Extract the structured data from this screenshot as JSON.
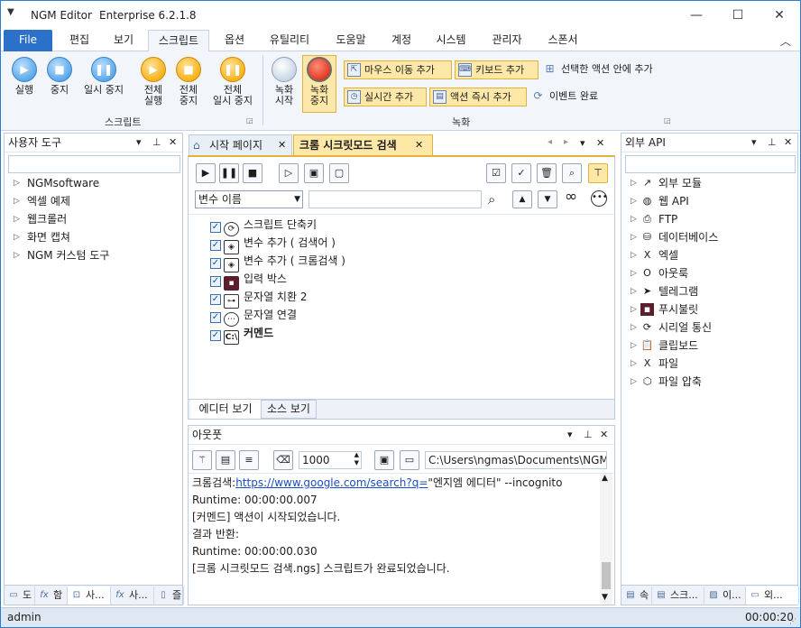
{
  "window": {
    "app_name": "NGM Editor",
    "edition": "Enterprise 6.2.1.8"
  },
  "menu": {
    "tabs": [
      "File",
      "편집",
      "보기",
      "스크립트",
      "옵션",
      "유틸리티",
      "도움말",
      "계정",
      "시스템",
      "관리자",
      "스폰서"
    ],
    "active": "스크립트"
  },
  "ribbon": {
    "script_group": {
      "label": "스크립트",
      "run": "실행",
      "stop": "중지",
      "pause": "일시 중지",
      "run_all_1": "전체",
      "run_all_2": "실행",
      "stop_all_1": "전체",
      "stop_all_2": "중지",
      "pause_all_1": "전체",
      "pause_all_2": "일시 중지"
    },
    "record_group": {
      "label": "녹화",
      "rec_start_1": "녹화",
      "rec_start_2": "시작",
      "rec_stop_1": "녹화",
      "rec_stop_2": "중지",
      "mouse_move": "마우스 이동 추가",
      "keyboard": "키보드 추가",
      "selected_action": "선택한 액션 안에 추가",
      "realtime": "실시간 추가",
      "immediate": "액션 즉시 추가",
      "event_done": "이벤트 완료"
    }
  },
  "left_panel": {
    "title": "사용자 도구",
    "items": [
      "NGMsoftware",
      "엑셀 예제",
      "웹크롤러",
      "화면 캡쳐",
      "NGM 커스텀 도구"
    ],
    "bottom_tabs": [
      "도",
      "함",
      "사...",
      "사...",
      "즐"
    ]
  },
  "doc_tabs": {
    "start": "시작 페이지",
    "active": "크롬 시크릿모드 검색"
  },
  "editor": {
    "var_dropdown": "변수 이름",
    "repeat_glyph": "∞",
    "items": [
      "스크립트 단축키",
      "변수 추가 ( 검색어 )",
      "변수 추가 ( 크롬검색 )",
      "입력 박스",
      "문자열 치환 2",
      "문자열 연결",
      "커멘드"
    ],
    "view_tabs": [
      "에디터 보기",
      "소스 보기"
    ]
  },
  "output": {
    "title": "아웃풋",
    "count": "1000",
    "path": "C:\\Users\\ngmas\\Documents\\NGM6\\",
    "lines": {
      "l1_prefix": "크롬검색:",
      "l1_link": "https://www.google.com/search?q=",
      "l1_suffix": "\"엔지엠 에디터\" --incognito",
      "l2": "Runtime: 00:00:00.007",
      "l3": "[커멘드] 액션이 시작되었습니다.",
      "l4": "결과 반환:",
      "l5": "Runtime: 00:00:00.030",
      "l6": "[크롬 시크릿모드 검색.ngs] 스크립트가 완료되었습니다."
    }
  },
  "right_panel": {
    "title": "외부 API",
    "items": [
      "외부 모듈",
      "웹 API",
      "FTP",
      "데이터베이스",
      "엑셀",
      "아웃룩",
      "텔레그램",
      "푸시불릿",
      "시리얼 통신",
      "클립보드",
      "파일",
      "파일 압축"
    ],
    "bottom_tabs": [
      "속",
      "스크...",
      "이...",
      "외..."
    ]
  },
  "status": {
    "user": "admin",
    "time": "00:00:20"
  },
  "colors": {
    "accent": "#2b70c9",
    "highlight": "#fde8a8",
    "highlight_border": "#e2b23a",
    "link": "#1a4fbf"
  }
}
